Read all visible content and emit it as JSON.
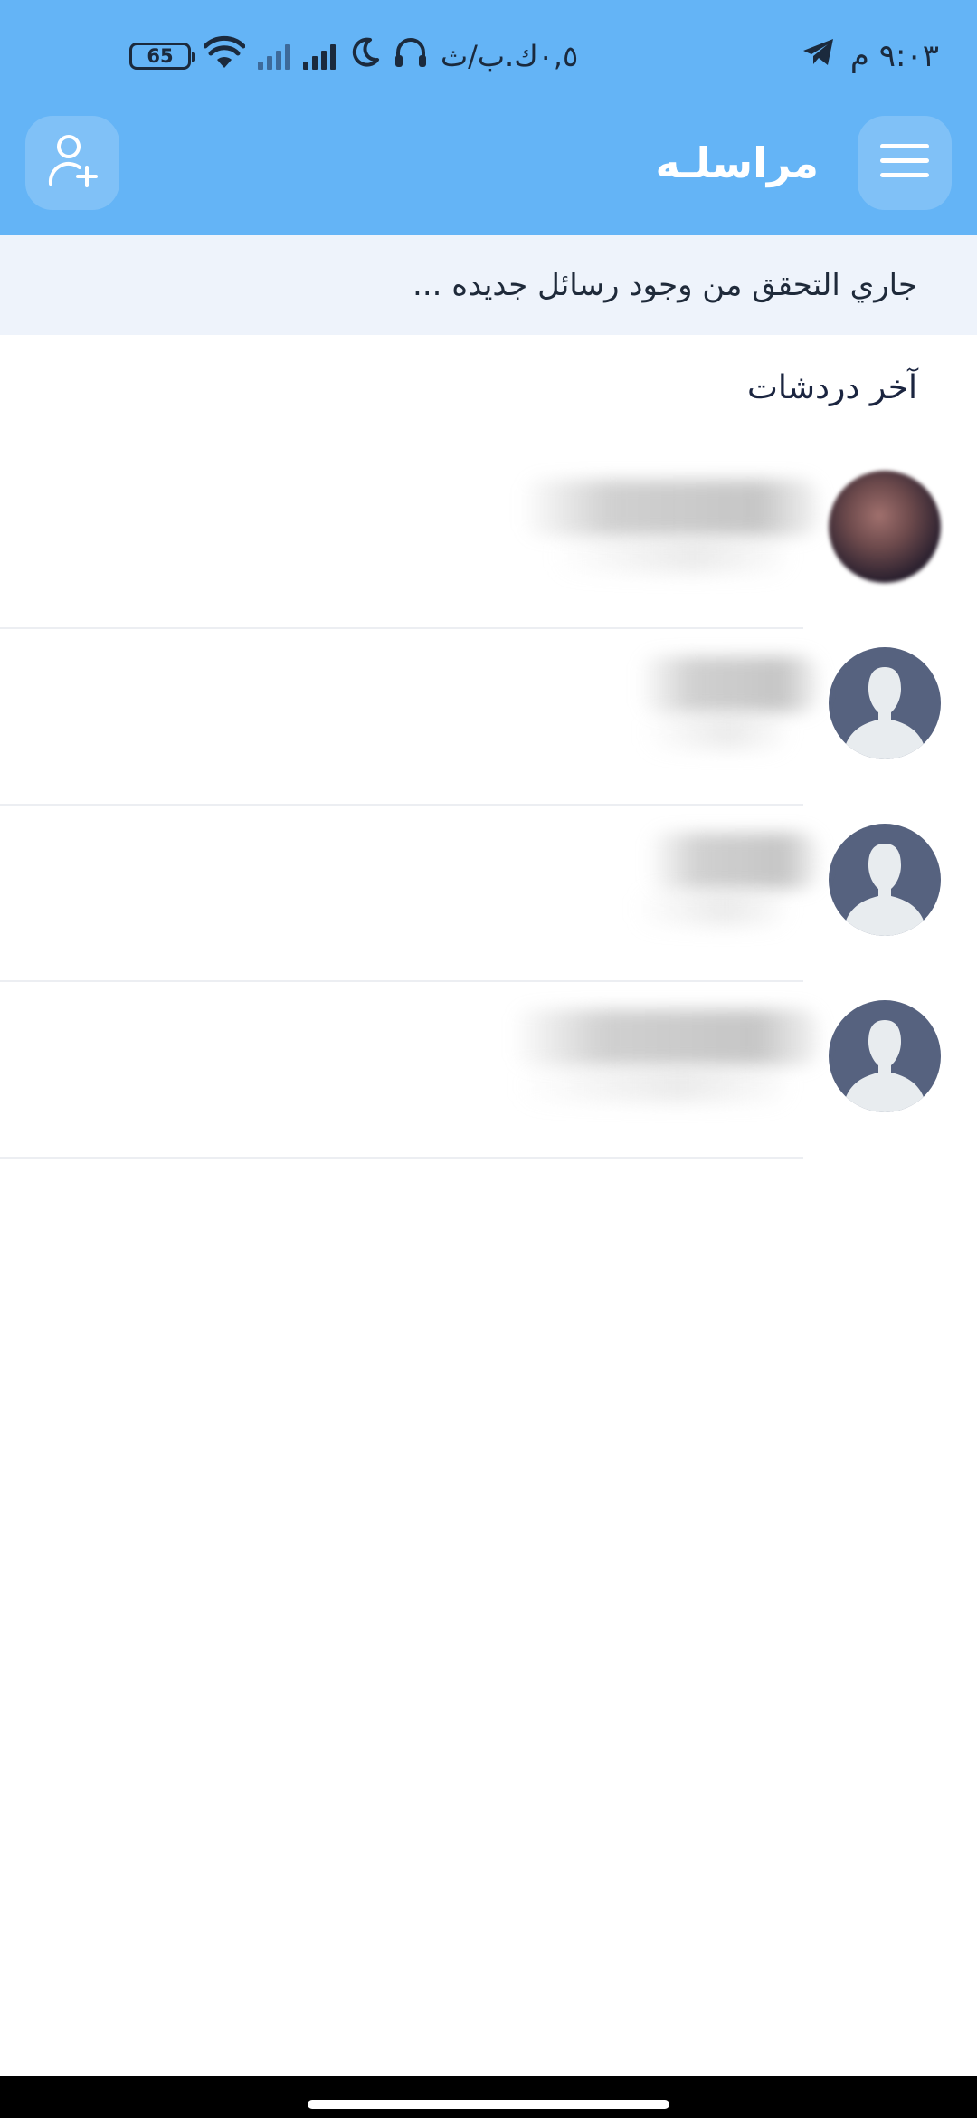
{
  "status_bar": {
    "time": "٩:٠٣ م",
    "network_speed": "٠,٥ك.ب/ث",
    "battery_level": "65",
    "icons": [
      "telegram-icon",
      "headphones-icon",
      "moon-icon",
      "signal-icon",
      "signal-faded-icon",
      "wifi-icon",
      "battery-icon"
    ]
  },
  "app_bar": {
    "title": "مراسلـه",
    "menu_icon": "hamburger-menu-icon",
    "add_user_icon": "add-user-icon"
  },
  "sync_banner": {
    "text": "جاري التحقق من وجود رسائل جديده ..."
  },
  "recent_chats": {
    "title": "آخر دردشات",
    "items": [
      {
        "name": "",
        "preview": "",
        "avatar": "photo"
      },
      {
        "name": "",
        "preview": "",
        "avatar": "default-user-icon"
      },
      {
        "name": "",
        "preview": "",
        "avatar": "default-user-icon"
      },
      {
        "name": "",
        "preview": "",
        "avatar": "default-user-icon"
      }
    ]
  },
  "colors": {
    "header_blue": "#64b4f6",
    "banner_bg": "#eef3fb",
    "avatar_default_bg": "#56627f",
    "avatar_default_fg": "#e8ecef"
  }
}
